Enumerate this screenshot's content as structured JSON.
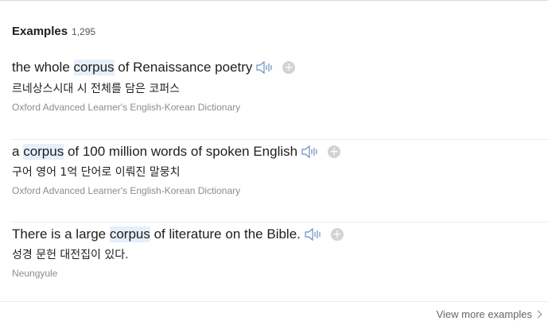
{
  "header": {
    "title": "Examples",
    "count": "1,295"
  },
  "examples": [
    {
      "before": "the whole ",
      "highlight": "corpus",
      "after": " of Renaissance poetry",
      "translation": "르네상스시대 시 전체를 담은 코퍼스",
      "source": "Oxford Advanced Learner's English-Korean Dictionary",
      "speaker_icon": "speaker-icon",
      "add_icon": "+"
    },
    {
      "before": "a ",
      "highlight": "corpus",
      "after": " of 100 million words of spoken English",
      "translation": "구어 영어 1억 단어로 이뤄진 말뭉치",
      "source": "Oxford Advanced Learner's English-Korean Dictionary",
      "speaker_icon": "speaker-icon",
      "add_icon": "+"
    },
    {
      "before": "There is a large ",
      "highlight": "corpus",
      "after": " of literature on the Bible.",
      "translation": "성경 문헌 대전집이 있다.",
      "source": "Neungyule",
      "speaker_icon": "speaker-icon",
      "add_icon": "+"
    }
  ],
  "footer": {
    "more_label": "View more examples"
  },
  "colors": {
    "highlight": "#e6f0fb",
    "source_text": "#8c8c8c",
    "plus_bg": "#d3d3d3"
  }
}
